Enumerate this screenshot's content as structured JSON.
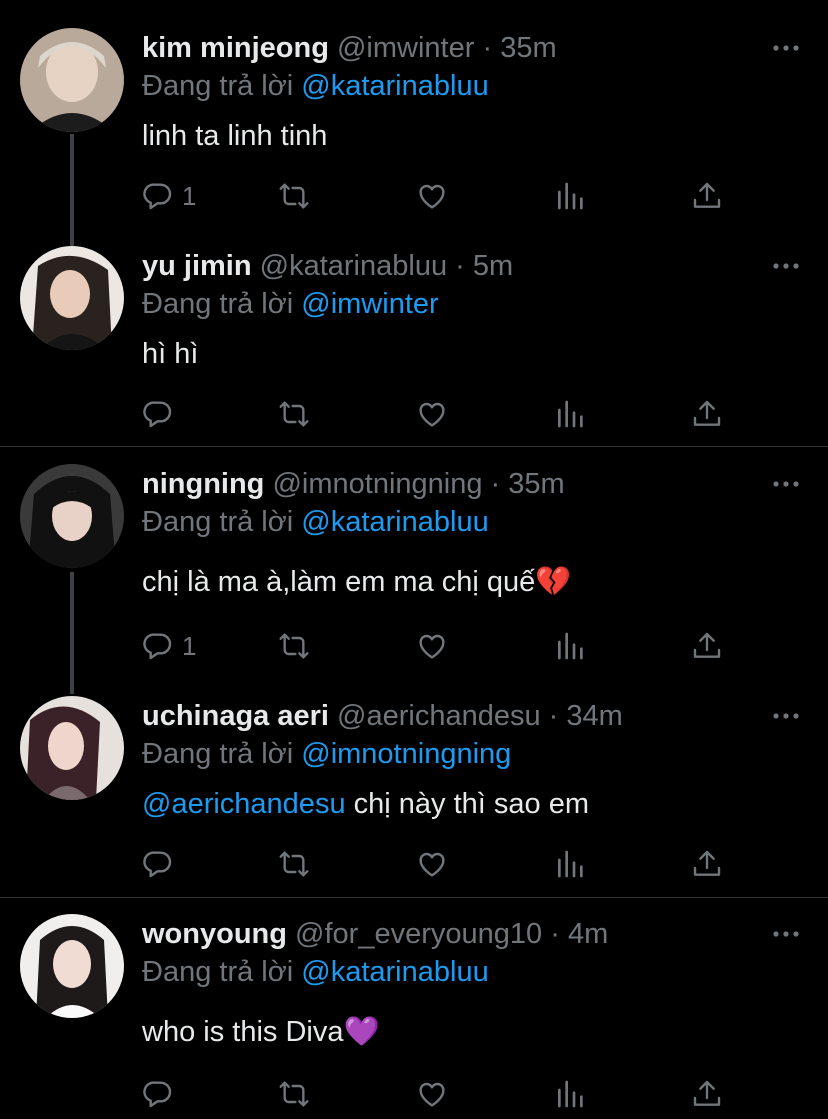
{
  "colors": {
    "background": "#000000",
    "text": "#e7e9ea",
    "muted": "#71767b",
    "link": "#1d9bf0",
    "divider": "#2f3336"
  },
  "tweets": [
    {
      "name": "kim minjeong",
      "handle": "@imwinter",
      "dot": "·",
      "time": "35m",
      "reply_prefix": "Đang trả lời",
      "reply_to": "@katarinabluu",
      "text": "linh ta linh tinh",
      "reply_count": "1",
      "icons": [
        "reply-icon",
        "retweet-icon",
        "like-icon",
        "analytics-icon",
        "share-icon",
        "more-icon"
      ]
    },
    {
      "name": "yu jimin",
      "handle": "@katarinabluu",
      "dot": "·",
      "time": "5m",
      "reply_prefix": "Đang trả lời",
      "reply_to": "@imwinter",
      "text": "hì hì",
      "reply_count": ""
    },
    {
      "name": "ningning",
      "handle": "@imnotningning",
      "dot": "·",
      "time": "35m",
      "reply_prefix": "Đang trả lời",
      "reply_to": "@katarinabluu",
      "text": "chị là ma à,làm em ma chị quế💔",
      "reply_count": "1"
    },
    {
      "name": "uchinaga aeri",
      "handle": "@aerichandesu",
      "dot": "·",
      "time": "34m",
      "reply_prefix": "Đang trả lời",
      "reply_to": "@imnotningning",
      "text_mention": "@aerichandesu",
      "text": " chị này thì sao em",
      "reply_count": ""
    },
    {
      "name": "wonyoung",
      "handle": "@for_everyoung10",
      "dot": "·",
      "time": "4m",
      "reply_prefix": "Đang trả lời",
      "reply_to": "@katarinabluu",
      "text": "who is this Diva💜",
      "reply_count": ""
    }
  ]
}
